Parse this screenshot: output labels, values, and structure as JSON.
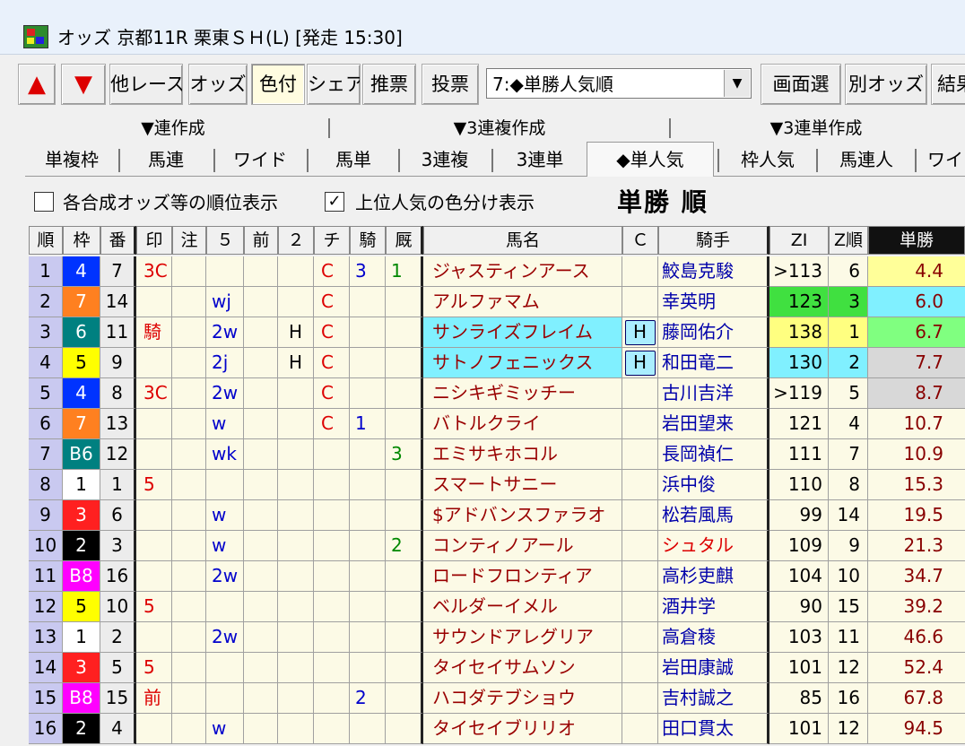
{
  "window": {
    "title": "オッズ 京都11R 栗東ＳＨ(L) [発走 15:30]"
  },
  "toolbar": {
    "up_icon": "up-arrow-icon",
    "down_icon": "down-arrow-icon",
    "buttons": [
      "他レース",
      "オッズ",
      "色付",
      "シェア",
      "推票",
      "投票"
    ],
    "combo_value": "7:◆単勝人気順",
    "right_buttons": [
      "画面選",
      "別オッズ",
      "結果"
    ]
  },
  "tabs_top": [
    "▼連作成",
    "▼3連複作成",
    "▼3連単作成"
  ],
  "tabs": [
    "単複枠",
    "馬連",
    "ワイド",
    "馬単",
    "3連複",
    "3連単",
    "◆単人気",
    "枠人気",
    "馬連人",
    "ワイ"
  ],
  "options": {
    "rank_display": "各合成オッズ等の順位表示",
    "color_display": "上位人気の色分け表示",
    "rank_checked": false,
    "color_checked": true,
    "heading": "単勝 順"
  },
  "columns": [
    "順",
    "枠",
    "番",
    "印",
    "注",
    "５",
    "前",
    "２",
    "チ",
    "騎",
    "厩",
    "馬名",
    "Ｃ",
    "騎手",
    "ZI",
    "Z順",
    "単勝"
  ],
  "colors": {
    "waku": {
      "1": "#ffffff",
      "2": "#000000",
      "3": "#ff2020",
      "4": "#0033ff",
      "5": "#ffff00",
      "6": "#008080",
      "7": "#ff8020",
      "8": "#ff00ff"
    },
    "highlight_cyan": "#80f0ff",
    "highlight_green": "#40e040",
    "highlight_yellow": "#ffff80",
    "highlight_gray": "#d8d8d8",
    "odds_light_green": "#80ff80",
    "odds_light_yellow": "#ffff99"
  },
  "rows": [
    {
      "rank": "1",
      "waku": "4",
      "waku_color": 4,
      "ban": "7",
      "mark": "3C",
      "chu": "",
      "five": "",
      "mae": "",
      "two": "",
      "chi": "C",
      "ki": "3",
      "kyu": "1",
      "name": "ジャスティンアース",
      "name_bg": "",
      "c": "",
      "jockey": "鮫島克駿",
      "zi": ">113",
      "zi_bg": "",
      "zr": "6",
      "zr_bg": "",
      "odds": "4.4",
      "odds_bg": "#ffff99"
    },
    {
      "rank": "2",
      "waku": "7",
      "waku_color": 7,
      "ban": "14",
      "mark": "",
      "chu": "",
      "five": "wj",
      "mae": "",
      "two": "",
      "chi": "C",
      "ki": "",
      "kyu": "",
      "name": "アルファマム",
      "name_bg": "",
      "c": "",
      "jockey": "幸英明",
      "zi": "123",
      "zi_bg": "#40e040",
      "zr": "3",
      "zr_bg": "#40e040",
      "odds": "6.0",
      "odds_bg": "#80f0ff"
    },
    {
      "rank": "3",
      "waku": "6",
      "waku_color": 6,
      "ban": "11",
      "mark": "騎",
      "chu": "",
      "five": "2w",
      "mae": "",
      "two": "H",
      "chi": "C",
      "ki": "",
      "kyu": "",
      "name": "サンライズフレイム",
      "name_bg": "#80f0ff",
      "c": "H",
      "jockey": "藤岡佑介",
      "zi": "138",
      "zi_bg": "#ffff80",
      "zr": "1",
      "zr_bg": "#ffff80",
      "odds": "6.7",
      "odds_bg": "#80ff80"
    },
    {
      "rank": "4",
      "waku": "5",
      "waku_color": 5,
      "ban": "9",
      "mark": "",
      "chu": "",
      "five": "2j",
      "mae": "",
      "two": "H",
      "chi": "C",
      "ki": "",
      "kyu": "",
      "name": "サトノフェニックス",
      "name_bg": "#80f0ff",
      "c": "H",
      "jockey": "和田竜二",
      "zi": "130",
      "zi_bg": "#80f0ff",
      "zr": "2",
      "zr_bg": "#80f0ff",
      "odds": "7.7",
      "odds_bg": "#d8d8d8"
    },
    {
      "rank": "5",
      "waku": "4",
      "waku_color": 4,
      "ban": "8",
      "mark": "3C",
      "chu": "",
      "five": "2w",
      "mae": "",
      "two": "",
      "chi": "C",
      "ki": "",
      "kyu": "",
      "name": "ニシキギミッチー",
      "name_bg": "",
      "c": "",
      "jockey": "古川吉洋",
      "zi": ">119",
      "zi_bg": "",
      "zr": "5",
      "zr_bg": "",
      "odds": "8.7",
      "odds_bg": "#d8d8d8"
    },
    {
      "rank": "6",
      "waku": "7",
      "waku_color": 7,
      "ban": "13",
      "mark": "",
      "chu": "",
      "five": "w",
      "mae": "",
      "two": "",
      "chi": "C",
      "ki": "1",
      "kyu": "",
      "name": "バトルクライ",
      "name_bg": "",
      "c": "",
      "jockey": "岩田望来",
      "zi": "121",
      "zi_bg": "",
      "zr": "4",
      "zr_bg": "",
      "odds": "10.7",
      "odds_bg": ""
    },
    {
      "rank": "7",
      "waku": "B6",
      "waku_color": 6,
      "ban": "12",
      "mark": "",
      "chu": "",
      "five": "wk",
      "mae": "",
      "two": "",
      "chi": "",
      "ki": "",
      "kyu": "3",
      "name": "エミサキホコル",
      "name_bg": "",
      "c": "",
      "jockey": "長岡禎仁",
      "zi": "111",
      "zi_bg": "",
      "zr": "7",
      "zr_bg": "",
      "odds": "10.9",
      "odds_bg": ""
    },
    {
      "rank": "8",
      "waku": "1",
      "waku_color": 1,
      "ban": "1",
      "mark": "5",
      "chu": "",
      "five": "",
      "mae": "",
      "two": "",
      "chi": "",
      "ki": "",
      "kyu": "",
      "name": "スマートサニー",
      "name_bg": "",
      "c": "",
      "jockey": "浜中俊",
      "zi": "110",
      "zi_bg": "",
      "zr": "8",
      "zr_bg": "",
      "odds": "15.3",
      "odds_bg": ""
    },
    {
      "rank": "9",
      "waku": "3",
      "waku_color": 3,
      "ban": "6",
      "mark": "",
      "chu": "",
      "five": "w",
      "mae": "",
      "two": "",
      "chi": "",
      "ki": "",
      "kyu": "",
      "name": "$アドバンスファラオ",
      "name_bg": "",
      "c": "",
      "jockey": "松若風馬",
      "zi": "99",
      "zi_bg": "",
      "zr": "14",
      "zr_bg": "",
      "odds": "19.5",
      "odds_bg": ""
    },
    {
      "rank": "10",
      "waku": "2",
      "waku_color": 2,
      "ban": "3",
      "mark": "",
      "chu": "",
      "five": "w",
      "mae": "",
      "two": "",
      "chi": "",
      "ki": "",
      "kyu": "2",
      "name": "コンティノアール",
      "name_bg": "",
      "c": "",
      "jockey": "シュタル",
      "jockey_red": true,
      "zi": "109",
      "zi_bg": "",
      "zr": "9",
      "zr_bg": "",
      "odds": "21.3",
      "odds_bg": ""
    },
    {
      "rank": "11",
      "waku": "B8",
      "waku_color": 8,
      "ban": "16",
      "mark": "",
      "chu": "",
      "five": "2w",
      "mae": "",
      "two": "",
      "chi": "",
      "ki": "",
      "kyu": "",
      "name": "ロードフロンティア",
      "name_bg": "",
      "c": "",
      "jockey": "高杉吏麒",
      "zi": "104",
      "zi_bg": "",
      "zr": "10",
      "zr_bg": "",
      "odds": "34.7",
      "odds_bg": ""
    },
    {
      "rank": "12",
      "waku": "5",
      "waku_color": 5,
      "ban": "10",
      "mark": "5",
      "chu": "",
      "five": "",
      "mae": "",
      "two": "",
      "chi": "",
      "ki": "",
      "kyu": "",
      "name": "ベルダーイメル",
      "name_bg": "",
      "c": "",
      "jockey": "酒井学",
      "zi": "90",
      "zi_bg": "",
      "zr": "15",
      "zr_bg": "",
      "odds": "39.2",
      "odds_bg": ""
    },
    {
      "rank": "13",
      "waku": "1",
      "waku_color": 1,
      "ban": "2",
      "mark": "",
      "chu": "",
      "five": "2w",
      "mae": "",
      "two": "",
      "chi": "",
      "ki": "",
      "kyu": "",
      "name": "サウンドアレグリア",
      "name_bg": "",
      "c": "",
      "jockey": "高倉稜",
      "zi": "103",
      "zi_bg": "",
      "zr": "11",
      "zr_bg": "",
      "odds": "46.6",
      "odds_bg": ""
    },
    {
      "rank": "14",
      "waku": "3",
      "waku_color": 3,
      "ban": "5",
      "mark": "5",
      "chu": "",
      "five": "",
      "mae": "",
      "two": "",
      "chi": "",
      "ki": "",
      "kyu": "",
      "name": "タイセイサムソン",
      "name_bg": "",
      "c": "",
      "jockey": "岩田康誠",
      "zi": "101",
      "zi_bg": "",
      "zr": "12",
      "zr_bg": "",
      "odds": "52.4",
      "odds_bg": ""
    },
    {
      "rank": "15",
      "waku": "B8",
      "waku_color": 8,
      "ban": "15",
      "mark": "前",
      "chu": "",
      "five": "",
      "mae": "",
      "two": "",
      "chi": "",
      "ki": "2",
      "kyu": "",
      "name": "ハコダテブショウ",
      "name_bg": "",
      "c": "",
      "jockey": "吉村誠之",
      "zi": "85",
      "zi_bg": "",
      "zr": "16",
      "zr_bg": "",
      "odds": "67.8",
      "odds_bg": ""
    },
    {
      "rank": "16",
      "waku": "2",
      "waku_color": 2,
      "ban": "4",
      "mark": "",
      "chu": "",
      "five": "w",
      "mae": "",
      "two": "",
      "chi": "",
      "ki": "",
      "kyu": "",
      "name": "タイセイブリリオ",
      "name_bg": "",
      "c": "",
      "jockey": "田口貫太",
      "zi": "101",
      "zi_bg": "",
      "zr": "12",
      "zr_bg": "",
      "odds": "94.5",
      "odds_bg": ""
    }
  ]
}
